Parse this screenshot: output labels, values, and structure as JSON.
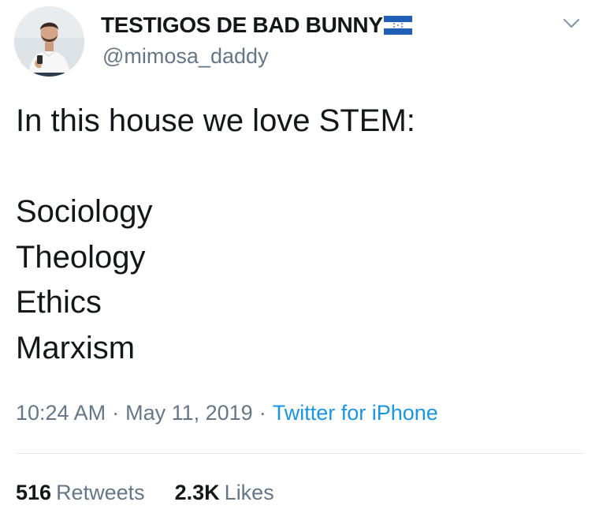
{
  "tweet": {
    "author": {
      "display_name": "TESTIGOS DE BAD BUNNY",
      "handle": "@mimosa_daddy",
      "flag_icon": "honduras-flag-icon"
    },
    "text_lines": [
      "In this house we love STEM:",
      "",
      "Sociology",
      "Theology",
      "Ethics",
      "Marxism"
    ],
    "meta": {
      "time": "10:24 AM",
      "separator": "·",
      "date": "May 11, 2019",
      "source": "Twitter for iPhone"
    },
    "stats": {
      "retweets_count": "516",
      "retweets_label": "Retweets",
      "likes_count": "2.3K",
      "likes_label": "Likes"
    }
  },
  "colors": {
    "text_primary": "#14171a",
    "text_secondary": "#657786",
    "link": "#1b95e0",
    "divider": "#e1e8ed",
    "flag_blue": "#1f5fb8"
  },
  "icons": {
    "menu": "chevron-down-icon",
    "avatar": "avatar"
  }
}
